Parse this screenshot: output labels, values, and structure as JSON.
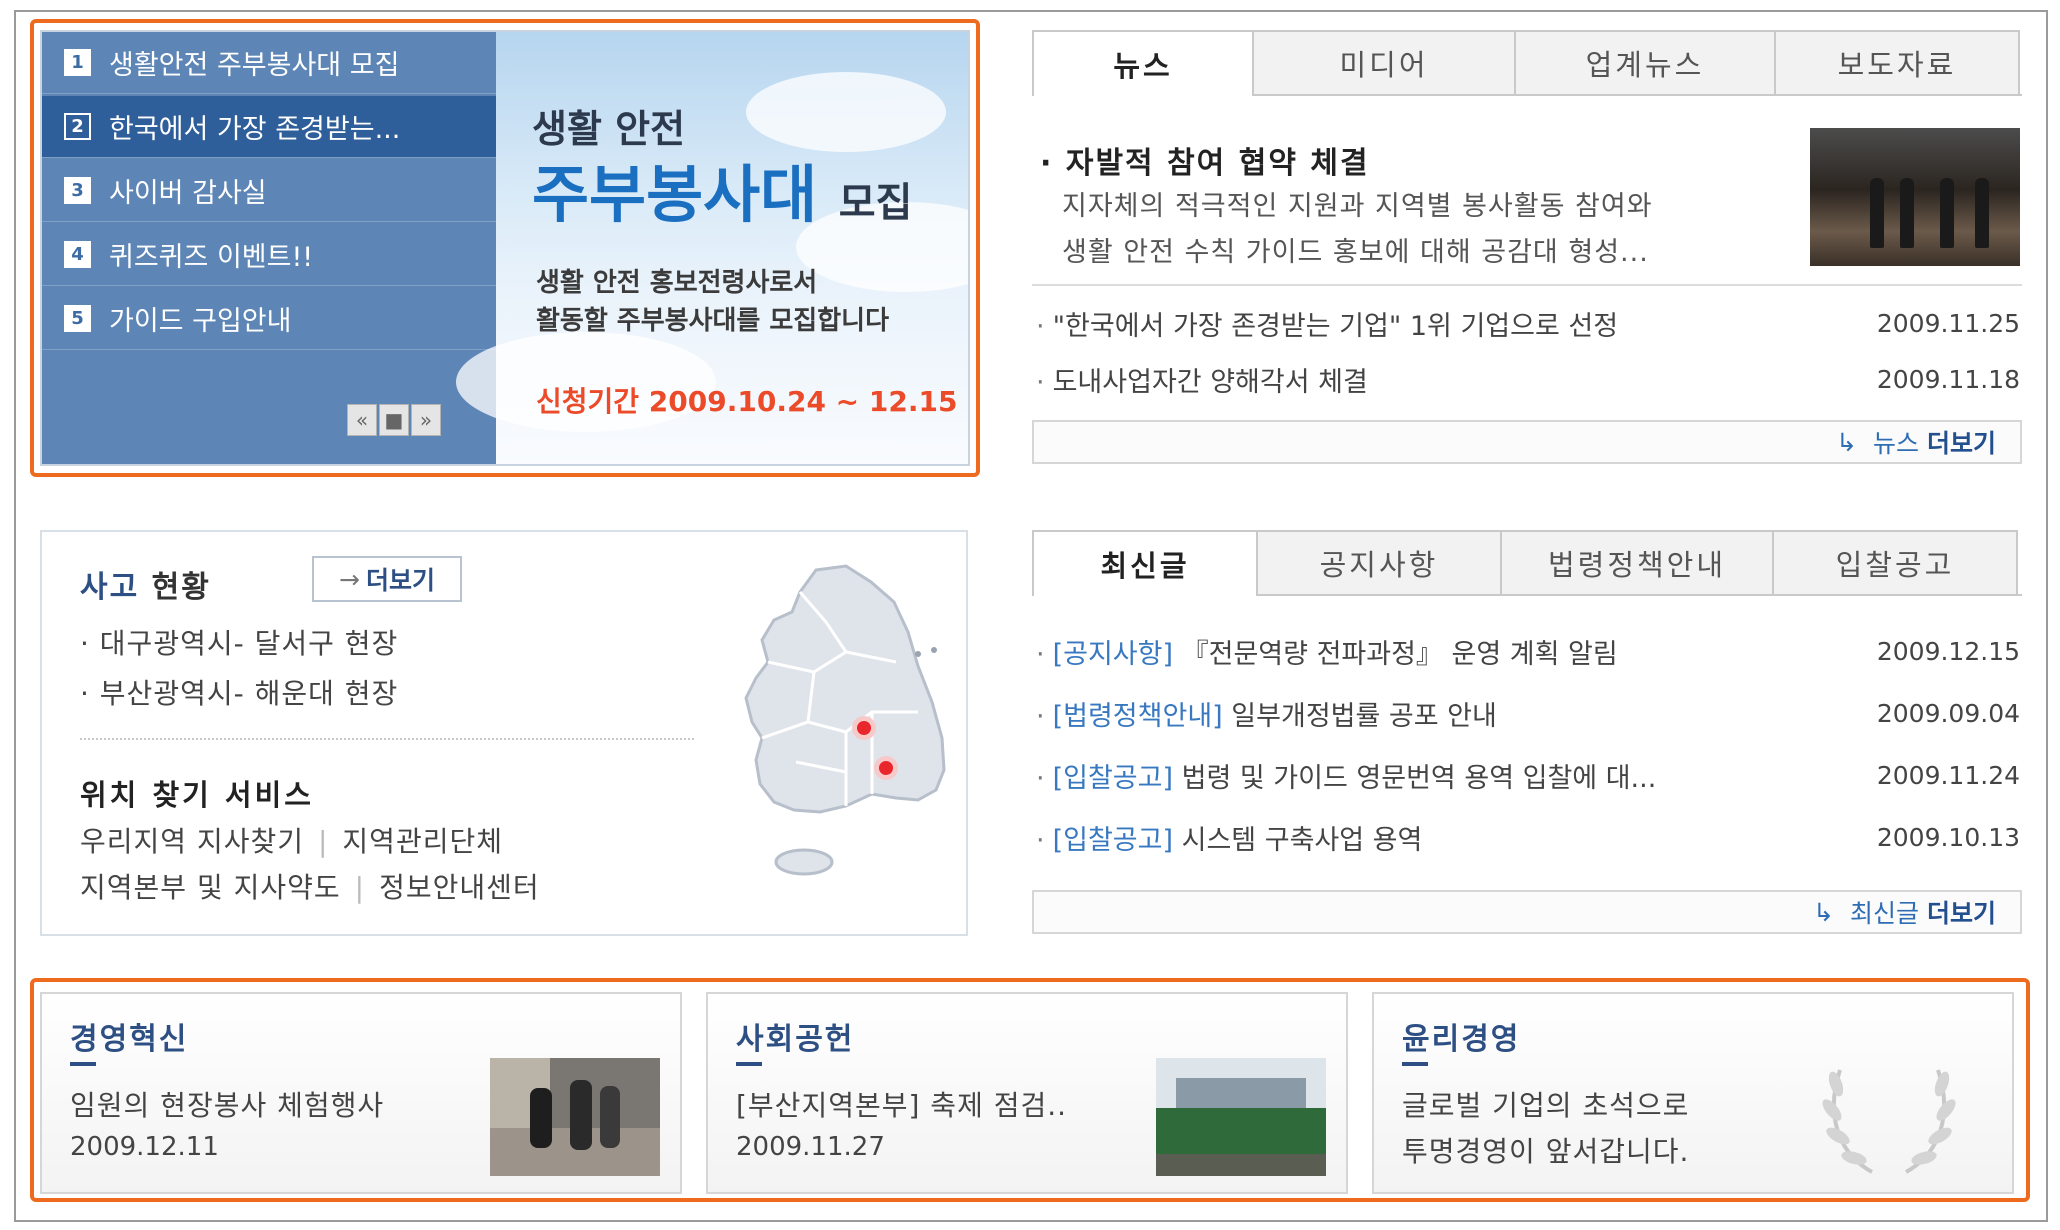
{
  "banner": {
    "items": [
      {
        "num": "1",
        "label": "생활안전 주부봉사대 모집"
      },
      {
        "num": "2",
        "label": "한국에서 가장 존경받는..."
      },
      {
        "num": "3",
        "label": "사이버 감사실"
      },
      {
        "num": "4",
        "label": "퀴즈퀴즈 이벤트!!"
      },
      {
        "num": "5",
        "label": "가이드 구입안내"
      }
    ],
    "controls": {
      "prev": "«",
      "stop": "■",
      "next": "»"
    },
    "visual": {
      "title_line1": "생활 안전",
      "title_line2_big": "주부봉사대",
      "title_line2_small": "모집",
      "desc_line1": "생활 안전 홍보전령사로서",
      "desc_line2": "활동할 주부봉사대를 모집합니다",
      "period": "신청기간 2009.10.24 ~ 12.15"
    }
  },
  "news": {
    "tabs": [
      "뉴스",
      "미디어",
      "업계뉴스",
      "보도자료"
    ],
    "feature": {
      "title": "· 자발적 참여 협약 체결",
      "line1": "지자체의 적극적인 지원과 지역별 봉사활동 참여와",
      "line2": "생활 안전 수칙 가이드 홍보에 대해  공감대 형성..."
    },
    "items": [
      {
        "title": "\"한국에서 가장 존경받는 기업\" 1위 기업으로 선정",
        "date": "2009.11.25"
      },
      {
        "title": "도내사업자간 양해각서 체결",
        "date": "2009.11.18"
      }
    ],
    "more_prefix": "뉴스",
    "more_label": "더보기"
  },
  "latest": {
    "tabs": [
      "최신글",
      "공지사항",
      "법령정책안내",
      "입찰공고"
    ],
    "items": [
      {
        "category": "[공지사항]",
        "title": "『전문역량 전파과정』 운영 계획 알림",
        "date": "2009.12.15"
      },
      {
        "category": "[법령정책안내]",
        "title": "일부개정법률 공포 안내",
        "date": "2009.09.04"
      },
      {
        "category": "[입찰공고]",
        "title": "법령 및 가이드 영문번역 용역 입찰에 대...",
        "date": "2009.11.24"
      },
      {
        "category": "[입찰공고]",
        "title": "시스템 구축사업 용역",
        "date": "2009.10.13"
      }
    ],
    "more_prefix": "최신글",
    "more_label": "더보기"
  },
  "accident": {
    "title_a": "사고",
    "title_b": "현황",
    "more": "더보기",
    "items": [
      "· 대구광역시- 달서구 현장",
      "· 부산광역시- 해운대 현장"
    ],
    "location_title": "위치 찾기 서비스",
    "links": [
      "우리지역 지사찾기",
      "지역관리단체",
      "지역본부 및 지사약도",
      "정보안내센터"
    ]
  },
  "cards": [
    {
      "title": "경영혁신",
      "text": "임원의 현장봉사 체험행사",
      "date": "2009.12.11"
    },
    {
      "title": "사회공헌",
      "text": "[부산지역본부] 축제 점검..",
      "date": "2009.11.27"
    },
    {
      "title": "윤리경영",
      "text": "글로벌 기업의 초석으로",
      "text2": "투명경영이 앞서갑니다."
    }
  ],
  "colors": {
    "highlight": "#ee6a1f",
    "menu_bg": "#5d86b6",
    "menu_active": "#2f5f9a",
    "link_blue": "#3878c0",
    "title_navy": "#2d4f84",
    "map_dot": "#e8262b"
  }
}
